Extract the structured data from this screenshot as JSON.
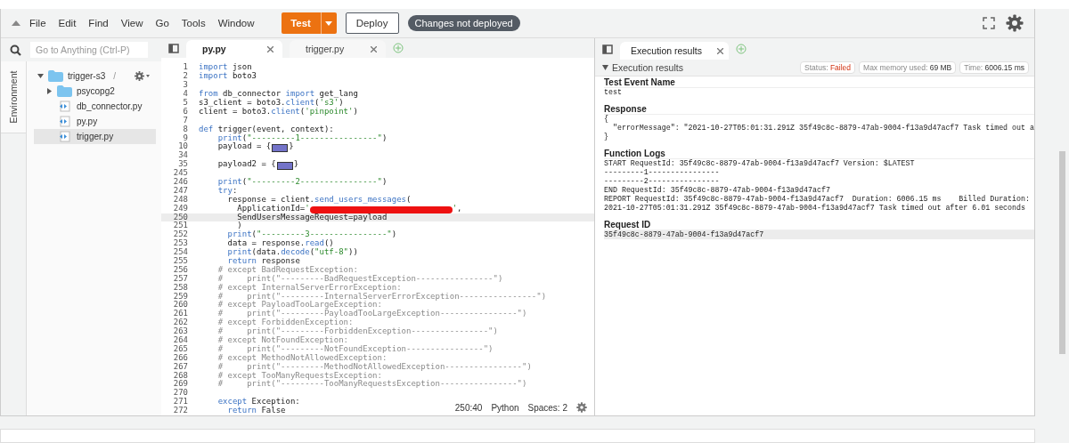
{
  "menu": [
    "File",
    "Edit",
    "Find",
    "View",
    "Go",
    "Tools",
    "Window"
  ],
  "toolbar": {
    "test": "Test",
    "deploy": "Deploy",
    "status_badge": "Changes not deployed"
  },
  "search": {
    "placeholder": "Go to Anything (Ctrl-P)"
  },
  "side_tab": "Environment",
  "tree": [
    {
      "name": "trigger-s3",
      "suffix": "/",
      "kind": "folder",
      "expanded": true,
      "selected": false,
      "children": [
        {
          "name": "psycopg2",
          "kind": "folder",
          "expanded": false,
          "selected": false
        },
        {
          "name": "db_connector.py",
          "kind": "file",
          "selected": false
        },
        {
          "name": "py.py",
          "kind": "file",
          "selected": false
        },
        {
          "name": "trigger.py",
          "kind": "file",
          "selected": true
        }
      ]
    }
  ],
  "editor_tabs": [
    {
      "label": "py.py",
      "selected": true
    },
    {
      "label": "trigger.py",
      "selected": false
    }
  ],
  "code": [
    {
      "num": "1",
      "active": false,
      "s": [
        {
          "kind": "kw",
          "text": "import"
        },
        {
          "text": " json"
        }
      ]
    },
    {
      "num": "2",
      "active": false,
      "s": [
        {
          "kind": "kw",
          "text": "import"
        },
        {
          "text": " boto3"
        }
      ]
    },
    {
      "num": "3",
      "active": false
    },
    {
      "num": "4",
      "active": false,
      "s": [
        {
          "kind": "kw",
          "text": "from"
        },
        {
          "text": " db_connector "
        },
        {
          "kind": "kw",
          "text": "import"
        },
        {
          "text": " get_lang"
        }
      ]
    },
    {
      "num": "5",
      "active": false,
      "s": [
        {
          "text": "s3_client = boto3."
        },
        {
          "kind": "fn",
          "text": "client"
        },
        {
          "text": "("
        },
        {
          "kind": "str",
          "text": "'s3'"
        },
        {
          "text": ")"
        }
      ]
    },
    {
      "num": "6",
      "active": false,
      "s": [
        {
          "text": "client = boto3."
        },
        {
          "kind": "fn",
          "text": "client"
        },
        {
          "text": "("
        },
        {
          "kind": "str",
          "text": "'pinpoint'"
        },
        {
          "text": ")"
        }
      ]
    },
    {
      "num": "7",
      "active": false
    },
    {
      "num": "8",
      "active": false,
      "s": [
        {
          "kind": "kw",
          "text": "def"
        },
        {
          "text": " trigger(event, context):"
        }
      ]
    },
    {
      "num": "9",
      "active": false,
      "s": [
        {
          "kind": "fn",
          "text": "    print"
        },
        {
          "text": "("
        },
        {
          "kind": "str",
          "text": "\"---------1----------------\""
        },
        {
          "text": ")"
        }
      ]
    },
    {
      "num": "10",
      "active": false,
      "s": [
        {
          "text": "    payload = {"
        },
        {
          "kind": "fold"
        },
        {
          "text": "}"
        }
      ]
    },
    {
      "num": "34",
      "active": false
    },
    {
      "num": "35",
      "active": false,
      "s": [
        {
          "text": "    payload2 = {"
        },
        {
          "kind": "fold"
        },
        {
          "text": "}"
        }
      ]
    },
    {
      "num": "245",
      "active": false
    },
    {
      "num": "246",
      "active": false,
      "s": [
        {
          "kind": "fn",
          "text": "    print"
        },
        {
          "text": "("
        },
        {
          "kind": "str",
          "text": "\"---------2----------------\""
        },
        {
          "text": ")"
        }
      ]
    },
    {
      "num": "247",
      "active": false,
      "s": [
        {
          "kind": "kw",
          "text": "    try"
        },
        {
          "text": ":"
        }
      ]
    },
    {
      "num": "248",
      "active": false,
      "s": [
        {
          "text": "      response = client."
        },
        {
          "kind": "fn",
          "text": "send_users_messages"
        },
        {
          "text": "("
        }
      ]
    },
    {
      "num": "249",
      "active": false,
      "s": [
        {
          "text": "        ApplicationId="
        },
        {
          "kind": "str",
          "text": "'"
        },
        {
          "kind": "redacted"
        },
        {
          "kind": "str",
          "text": "'"
        },
        {
          "text": ","
        }
      ]
    },
    {
      "num": "250",
      "active": true,
      "s": [
        {
          "text": "        SendUsersMessageRequest=payload"
        }
      ]
    },
    {
      "num": "251",
      "active": false,
      "s": [
        {
          "text": "        )"
        }
      ]
    },
    {
      "num": "252",
      "active": false,
      "s": [
        {
          "kind": "fn",
          "text": "      print"
        },
        {
          "text": "("
        },
        {
          "kind": "str",
          "text": "\"---------3----------------\""
        },
        {
          "text": ")"
        }
      ]
    },
    {
      "num": "253",
      "active": false,
      "s": [
        {
          "text": "      data = response."
        },
        {
          "kind": "fn",
          "text": "read"
        },
        {
          "text": "()"
        }
      ]
    },
    {
      "num": "254",
      "active": false,
      "s": [
        {
          "kind": "fn",
          "text": "      print"
        },
        {
          "text": "(data."
        },
        {
          "kind": "fn",
          "text": "decode"
        },
        {
          "text": "("
        },
        {
          "kind": "str",
          "text": "\"utf-8\""
        },
        {
          "text": "))"
        }
      ]
    },
    {
      "num": "255",
      "active": false,
      "s": [
        {
          "kind": "kw",
          "text": "      return"
        },
        {
          "text": " response"
        }
      ]
    },
    {
      "num": "256",
      "active": false,
      "s": [
        {
          "kind": "cm",
          "text": "    # except BadRequestException:"
        }
      ]
    },
    {
      "num": "257",
      "active": false,
      "s": [
        {
          "kind": "cm",
          "text": "    #     print(\"---------BadRequestException----------------\")"
        }
      ]
    },
    {
      "num": "258",
      "active": false,
      "s": [
        {
          "kind": "cm",
          "text": "    # except InternalServerErrorException:"
        }
      ]
    },
    {
      "num": "259",
      "active": false,
      "s": [
        {
          "kind": "cm",
          "text": "    #     print(\"---------InternalServerErrorException----------------\")"
        }
      ]
    },
    {
      "num": "260",
      "active": false,
      "s": [
        {
          "kind": "cm",
          "text": "    # except PayloadTooLargeException:"
        }
      ]
    },
    {
      "num": "261",
      "active": false,
      "s": [
        {
          "kind": "cm",
          "text": "    #     print(\"---------PayloadTooLargeException----------------\")"
        }
      ]
    },
    {
      "num": "262",
      "active": false,
      "s": [
        {
          "kind": "cm",
          "text": "    # except ForbiddenException:"
        }
      ]
    },
    {
      "num": "263",
      "active": false,
      "s": [
        {
          "kind": "cm",
          "text": "    #     print(\"---------ForbiddenException----------------\")"
        }
      ]
    },
    {
      "num": "264",
      "active": false,
      "s": [
        {
          "kind": "cm",
          "text": "    # except NotFoundException:"
        }
      ]
    },
    {
      "num": "265",
      "active": false,
      "s": [
        {
          "kind": "cm",
          "text": "    #     print(\"---------NotFoundException----------------\")"
        }
      ]
    },
    {
      "num": "266",
      "active": false,
      "s": [
        {
          "kind": "cm",
          "text": "    # except MethodNotAllowedException:"
        }
      ]
    },
    {
      "num": "267",
      "active": false,
      "s": [
        {
          "kind": "cm",
          "text": "    #     print(\"---------MethodNotAllowedException----------------\")"
        }
      ]
    },
    {
      "num": "268",
      "active": false,
      "s": [
        {
          "kind": "cm",
          "text": "    # except TooManyRequestsException:"
        }
      ]
    },
    {
      "num": "269",
      "active": false,
      "s": [
        {
          "kind": "cm",
          "text": "    #     print(\"---------TooManyRequestsException----------------\")"
        }
      ]
    },
    {
      "num": "270",
      "active": false
    },
    {
      "num": "271",
      "active": false,
      "s": [
        {
          "kind": "kw",
          "text": "    except"
        },
        {
          "text": " Exception:"
        }
      ]
    },
    {
      "num": "272",
      "active": false,
      "s": [
        {
          "kind": "kw",
          "text": "      return"
        },
        {
          "text": " False"
        }
      ]
    }
  ],
  "editor_status": {
    "position": "250:40",
    "language": "Python",
    "indent": "Spaces: 2"
  },
  "results_tab": {
    "label": "Execution results",
    "selected": true
  },
  "results": {
    "title": "Execution results",
    "badges": [
      {
        "label": "Status:",
        "value": "Failed",
        "failed": true
      },
      {
        "label": "Max memory used:",
        "value": "69 MB",
        "failed": false
      },
      {
        "label": "Time:",
        "value": "6006.15 ms",
        "failed": false
      }
    ],
    "sections": [
      {
        "heading": "Test Event Name",
        "highlighted": false,
        "lines": [
          "test"
        ]
      },
      {
        "heading": "Response",
        "highlighted": false,
        "lines": [
          "{",
          "  \"errorMessage\": \"2021-10-27T05:01:31.291Z 35f49c8c-8879-47ab-9004-f13a9d47acf7 Task timed out a",
          "}"
        ]
      },
      {
        "heading": "Function Logs",
        "highlighted": false,
        "lines": [
          "START RequestId: 35f49c8c-8879-47ab-9004-f13a9d47acf7 Version: $LATEST",
          "---------1----------------",
          "---------2----------------",
          "END RequestId: 35f49c8c-8879-47ab-9004-f13a9d47acf7",
          "REPORT RequestId: 35f49c8c-8879-47ab-9004-f13a9d47acf7  Duration: 6006.15 ms    Billed Duration:",
          "2021-10-27T05:01:31.291Z 35f49c8c-8879-47ab-9004-f13a9d47acf7 Task timed out after 6.01 seconds"
        ]
      },
      {
        "heading": "Request ID",
        "highlighted": true,
        "lines": [
          "35f49c8c-8879-47ab-9004-f13a9d47acf7"
        ]
      }
    ]
  }
}
